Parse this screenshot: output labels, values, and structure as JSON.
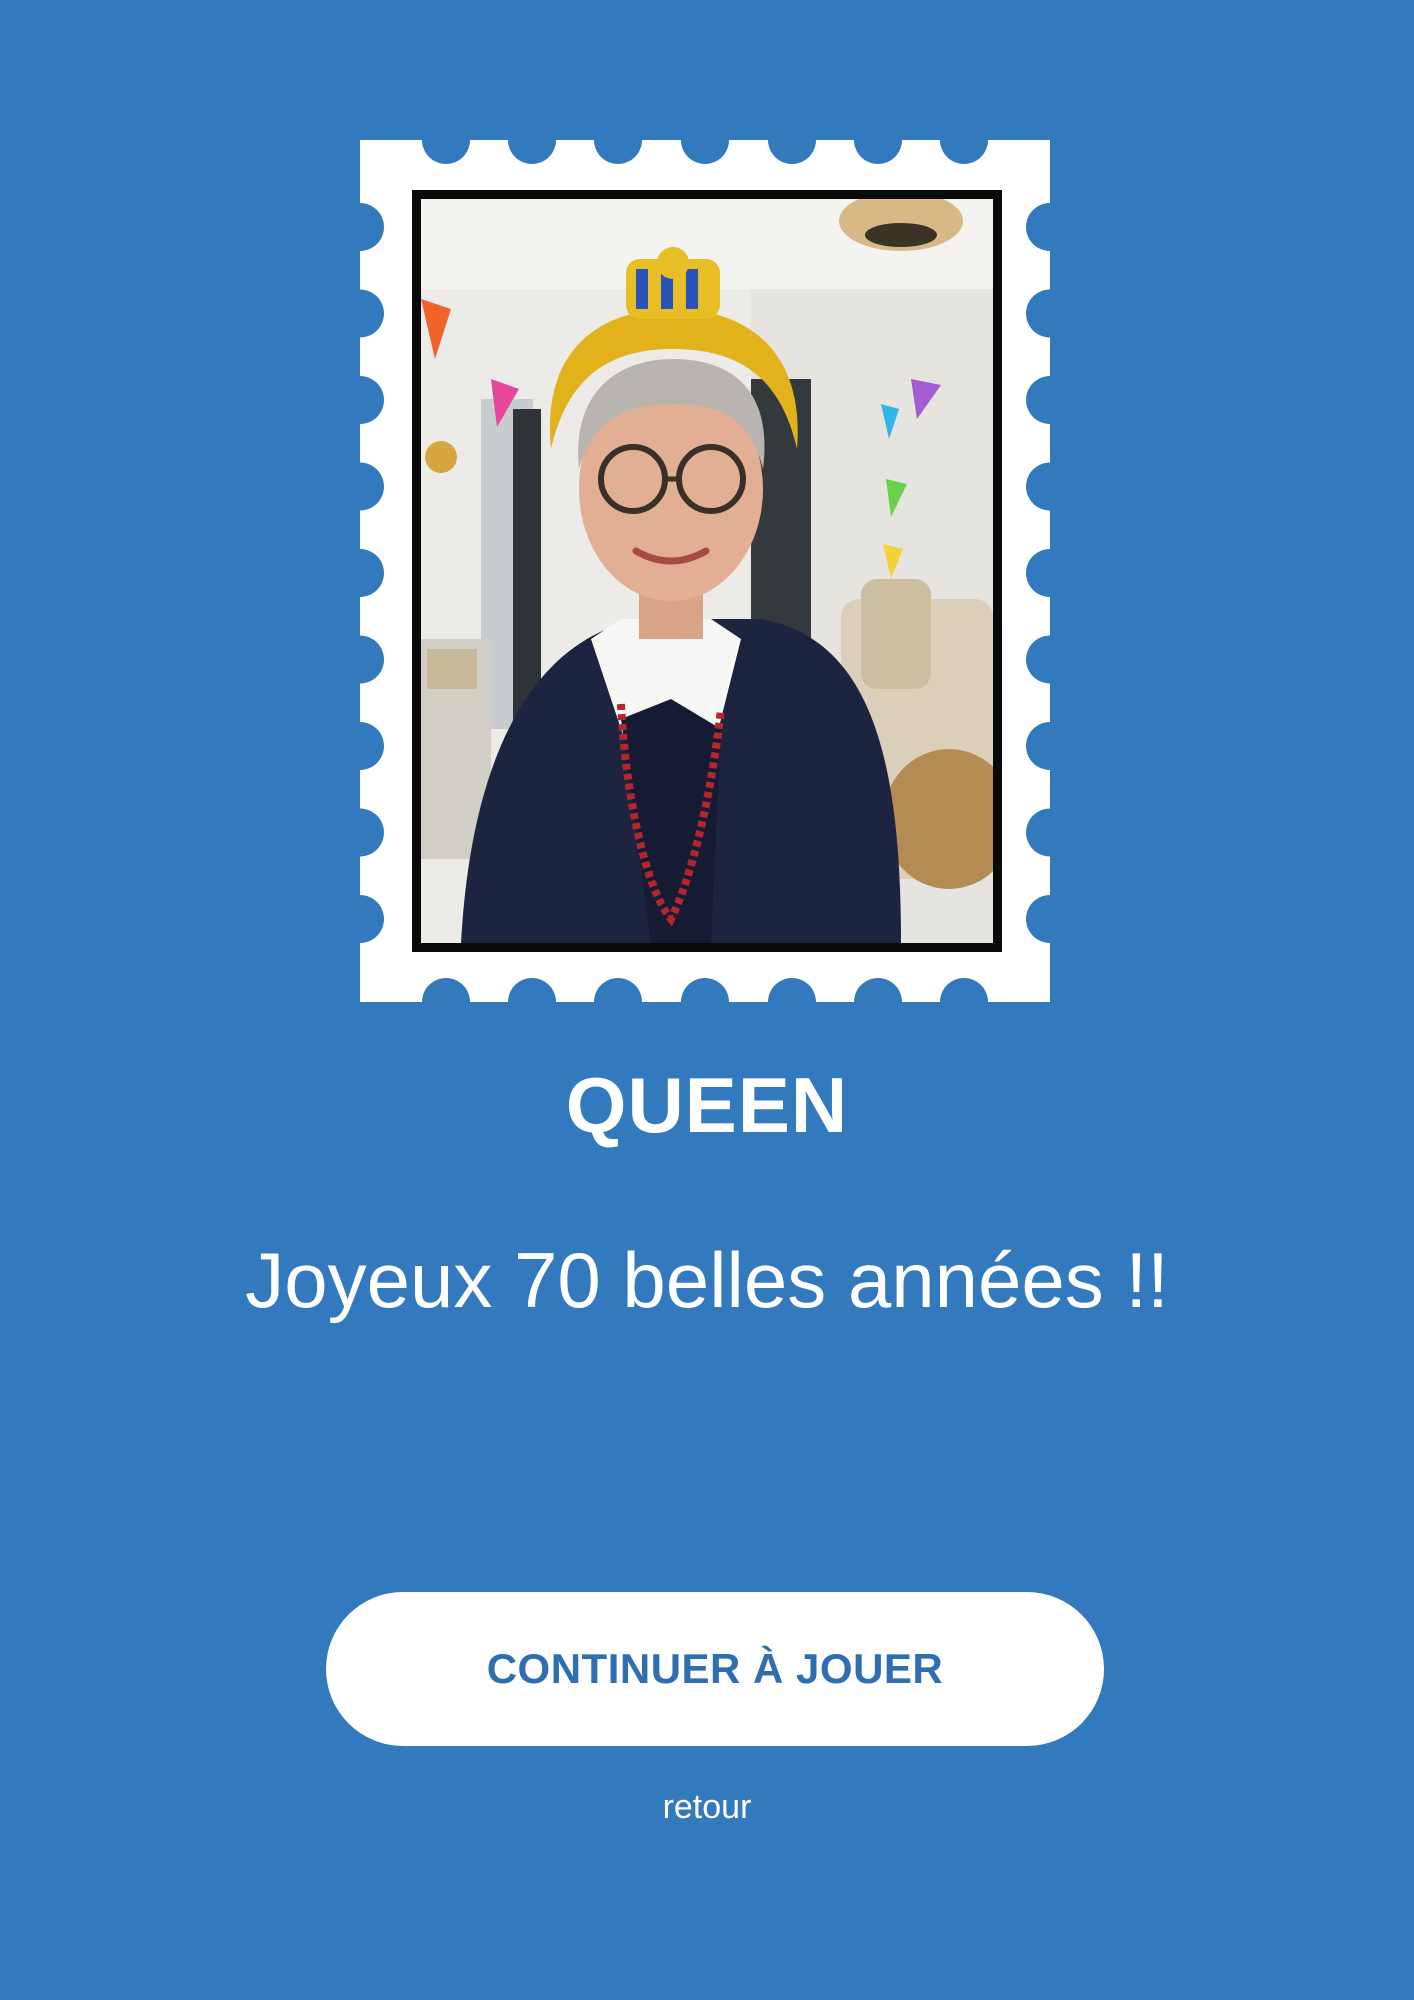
{
  "colors": {
    "background": "#3279bd",
    "stamp": "#ffffff",
    "button_text": "#2f6fb0"
  },
  "card": {
    "title": "QUEEN",
    "message": "Joyeux 70 belles années !!"
  },
  "actions": {
    "continue_label": "CONTINUER À JOUER",
    "back_label": "retour"
  }
}
